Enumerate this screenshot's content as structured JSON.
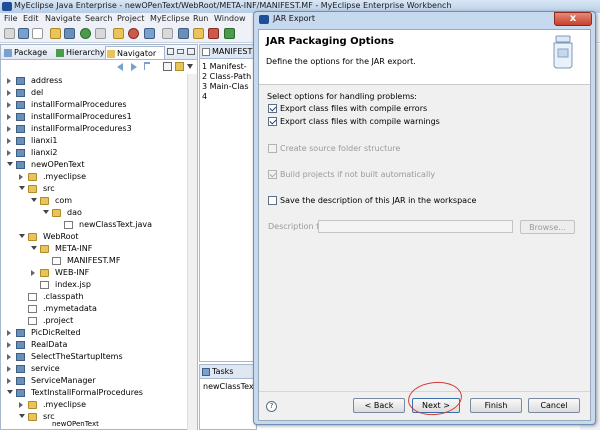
{
  "window": {
    "title": "MyEclipse Java Enterprise - newOPenText/WebRoot/META-INF/MANIFEST.MF - MyEclipse Enterprise Workbench"
  },
  "menu": [
    "File",
    "Edit",
    "Navigate",
    "Search",
    "Project",
    "MyEclipse",
    "Run",
    "Window"
  ],
  "left_panel": {
    "tabs": [
      {
        "label": "Package"
      },
      {
        "label": "Hierarchy"
      },
      {
        "label": "Navigator"
      }
    ],
    "tree": [
      {
        "label": "address"
      },
      {
        "label": "del"
      },
      {
        "label": "installFormalProcedures"
      },
      {
        "label": "installFormalProcedures1"
      },
      {
        "label": "installFormalProcedures3"
      },
      {
        "label": "lianxi1"
      },
      {
        "label": "lianxi2"
      },
      {
        "label": "newOPenText"
      },
      {
        "label": ".myeclipse"
      },
      {
        "label": "src"
      },
      {
        "label": "com"
      },
      {
        "label": "dao"
      },
      {
        "label": "newClassText.java"
      },
      {
        "label": "WebRoot"
      },
      {
        "label": "META-INF"
      },
      {
        "label": "MANIFEST.MF"
      },
      {
        "label": "WEB-INF"
      },
      {
        "label": "index.jsp"
      },
      {
        "label": ".classpath"
      },
      {
        "label": ".mymetadata"
      },
      {
        "label": ".project"
      },
      {
        "label": "PicDicRelted"
      },
      {
        "label": "RealData"
      },
      {
        "label": "SelectTheStartupItems"
      },
      {
        "label": "service"
      },
      {
        "label": "ServiceManager"
      },
      {
        "label": "TextInstallFormalProcedures"
      },
      {
        "label": ".myeclipse"
      },
      {
        "label": "src"
      }
    ]
  },
  "editor": {
    "tab": "MANIFEST",
    "lines": [
      "1 Manifest-",
      "2 Class-Path",
      "3 Main-Clas",
      "4"
    ]
  },
  "bottom_panel": {
    "tab": "Tasks",
    "text": "newClassText"
  },
  "status_bar": {
    "text": "newOPenText"
  },
  "dialog": {
    "title": "JAR Export",
    "close_glyph": "x",
    "header_title": "JAR Packaging Options",
    "header_desc": "Define the options for the JAR export.",
    "options_label": "Select options for handling problems:",
    "options": [
      {
        "label": "Export class files with compile errors",
        "checked": true,
        "enabled": true
      },
      {
        "label": "Export class files with compile warnings",
        "checked": true,
        "enabled": true
      },
      {
        "label": "Create source folder structure",
        "checked": false,
        "enabled": false
      },
      {
        "label": "Build projects if not built automatically",
        "checked": true,
        "enabled": false
      },
      {
        "label": "Save the description of this JAR in the workspace",
        "checked": false,
        "enabled": true
      }
    ],
    "desc_file_label": "Description file:",
    "desc_file_value": "",
    "browse": "Browse...",
    "help_glyph": "?",
    "buttons": {
      "back": "< Back",
      "next": "Next >",
      "finish": "Finish",
      "cancel": "Cancel"
    }
  }
}
